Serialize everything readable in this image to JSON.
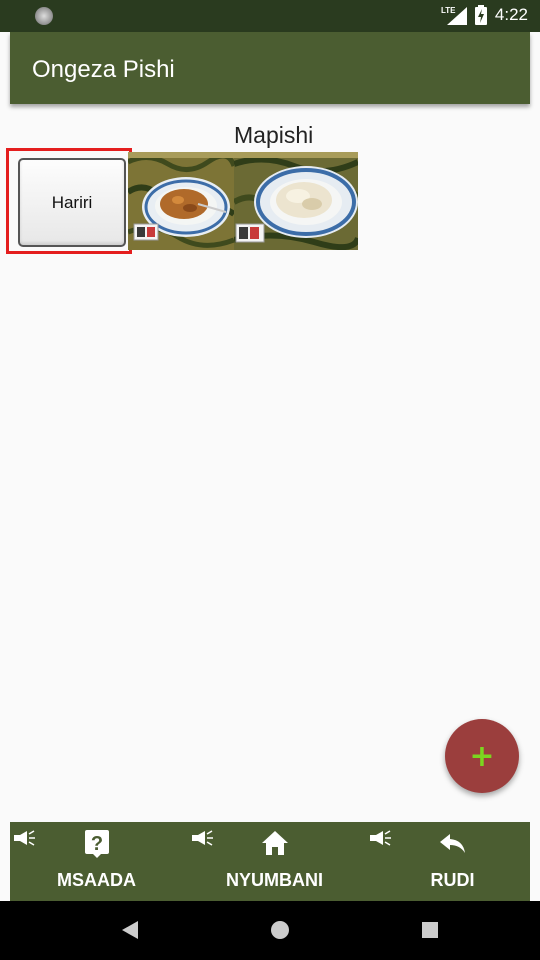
{
  "status_bar": {
    "network": "LTE",
    "time": "4:22"
  },
  "app_bar": {
    "title": "Ongeza Pishi"
  },
  "section": {
    "title": "Mapishi"
  },
  "edit_button": {
    "label": "Hariri"
  },
  "bottom_nav": {
    "items": [
      {
        "label": "MSAADA",
        "icon": "help-icon"
      },
      {
        "label": "NYUMBANI",
        "icon": "home-icon"
      },
      {
        "label": "RUDI",
        "icon": "back-arrow-icon"
      }
    ]
  },
  "fab": {
    "symbol": "+"
  },
  "colors": {
    "status_bar": "#2a3b1f",
    "app_bar": "#4b5d31",
    "fab": "#9b3e3d",
    "fab_icon": "#7bd61f",
    "highlight": "#e41e1e"
  }
}
